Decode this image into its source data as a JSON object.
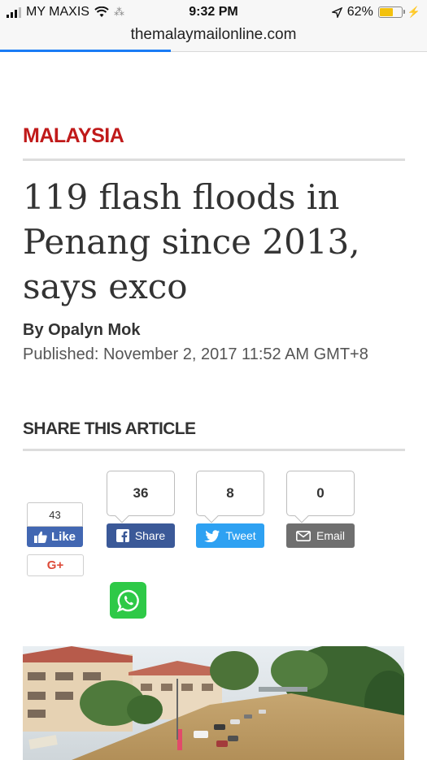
{
  "status_bar": {
    "carrier": "MY MAXIS",
    "time": "9:32 PM",
    "battery_percent": "62%",
    "battery_level": 0.62
  },
  "browser": {
    "url": "themalaymailonline.com",
    "load_progress": 0.4
  },
  "article": {
    "category": "MALAYSIA",
    "headline": "119 flash floods in Penang since 2013, says exco",
    "byline": "By Opalyn Mok",
    "published": "Published: November 2, 2017 11:52 AM GMT+8"
  },
  "share": {
    "heading": "SHARE THIS ARTICLE",
    "facebook_like_count": "43",
    "like_label": "Like",
    "gplus_label": "G+",
    "facebook_share_count": "36",
    "facebook_share_label": "Share",
    "tweet_count": "8",
    "tweet_label": "Tweet",
    "email_count": "0",
    "email_label": "Email"
  },
  "colors": {
    "category_red": "#c01a1a",
    "facebook_blue": "#3b5998",
    "twitter_blue": "#2ea1f2",
    "email_gray": "#6f6f6f",
    "whatsapp_green": "#2ec947",
    "progress_blue": "#1a7cf5"
  }
}
